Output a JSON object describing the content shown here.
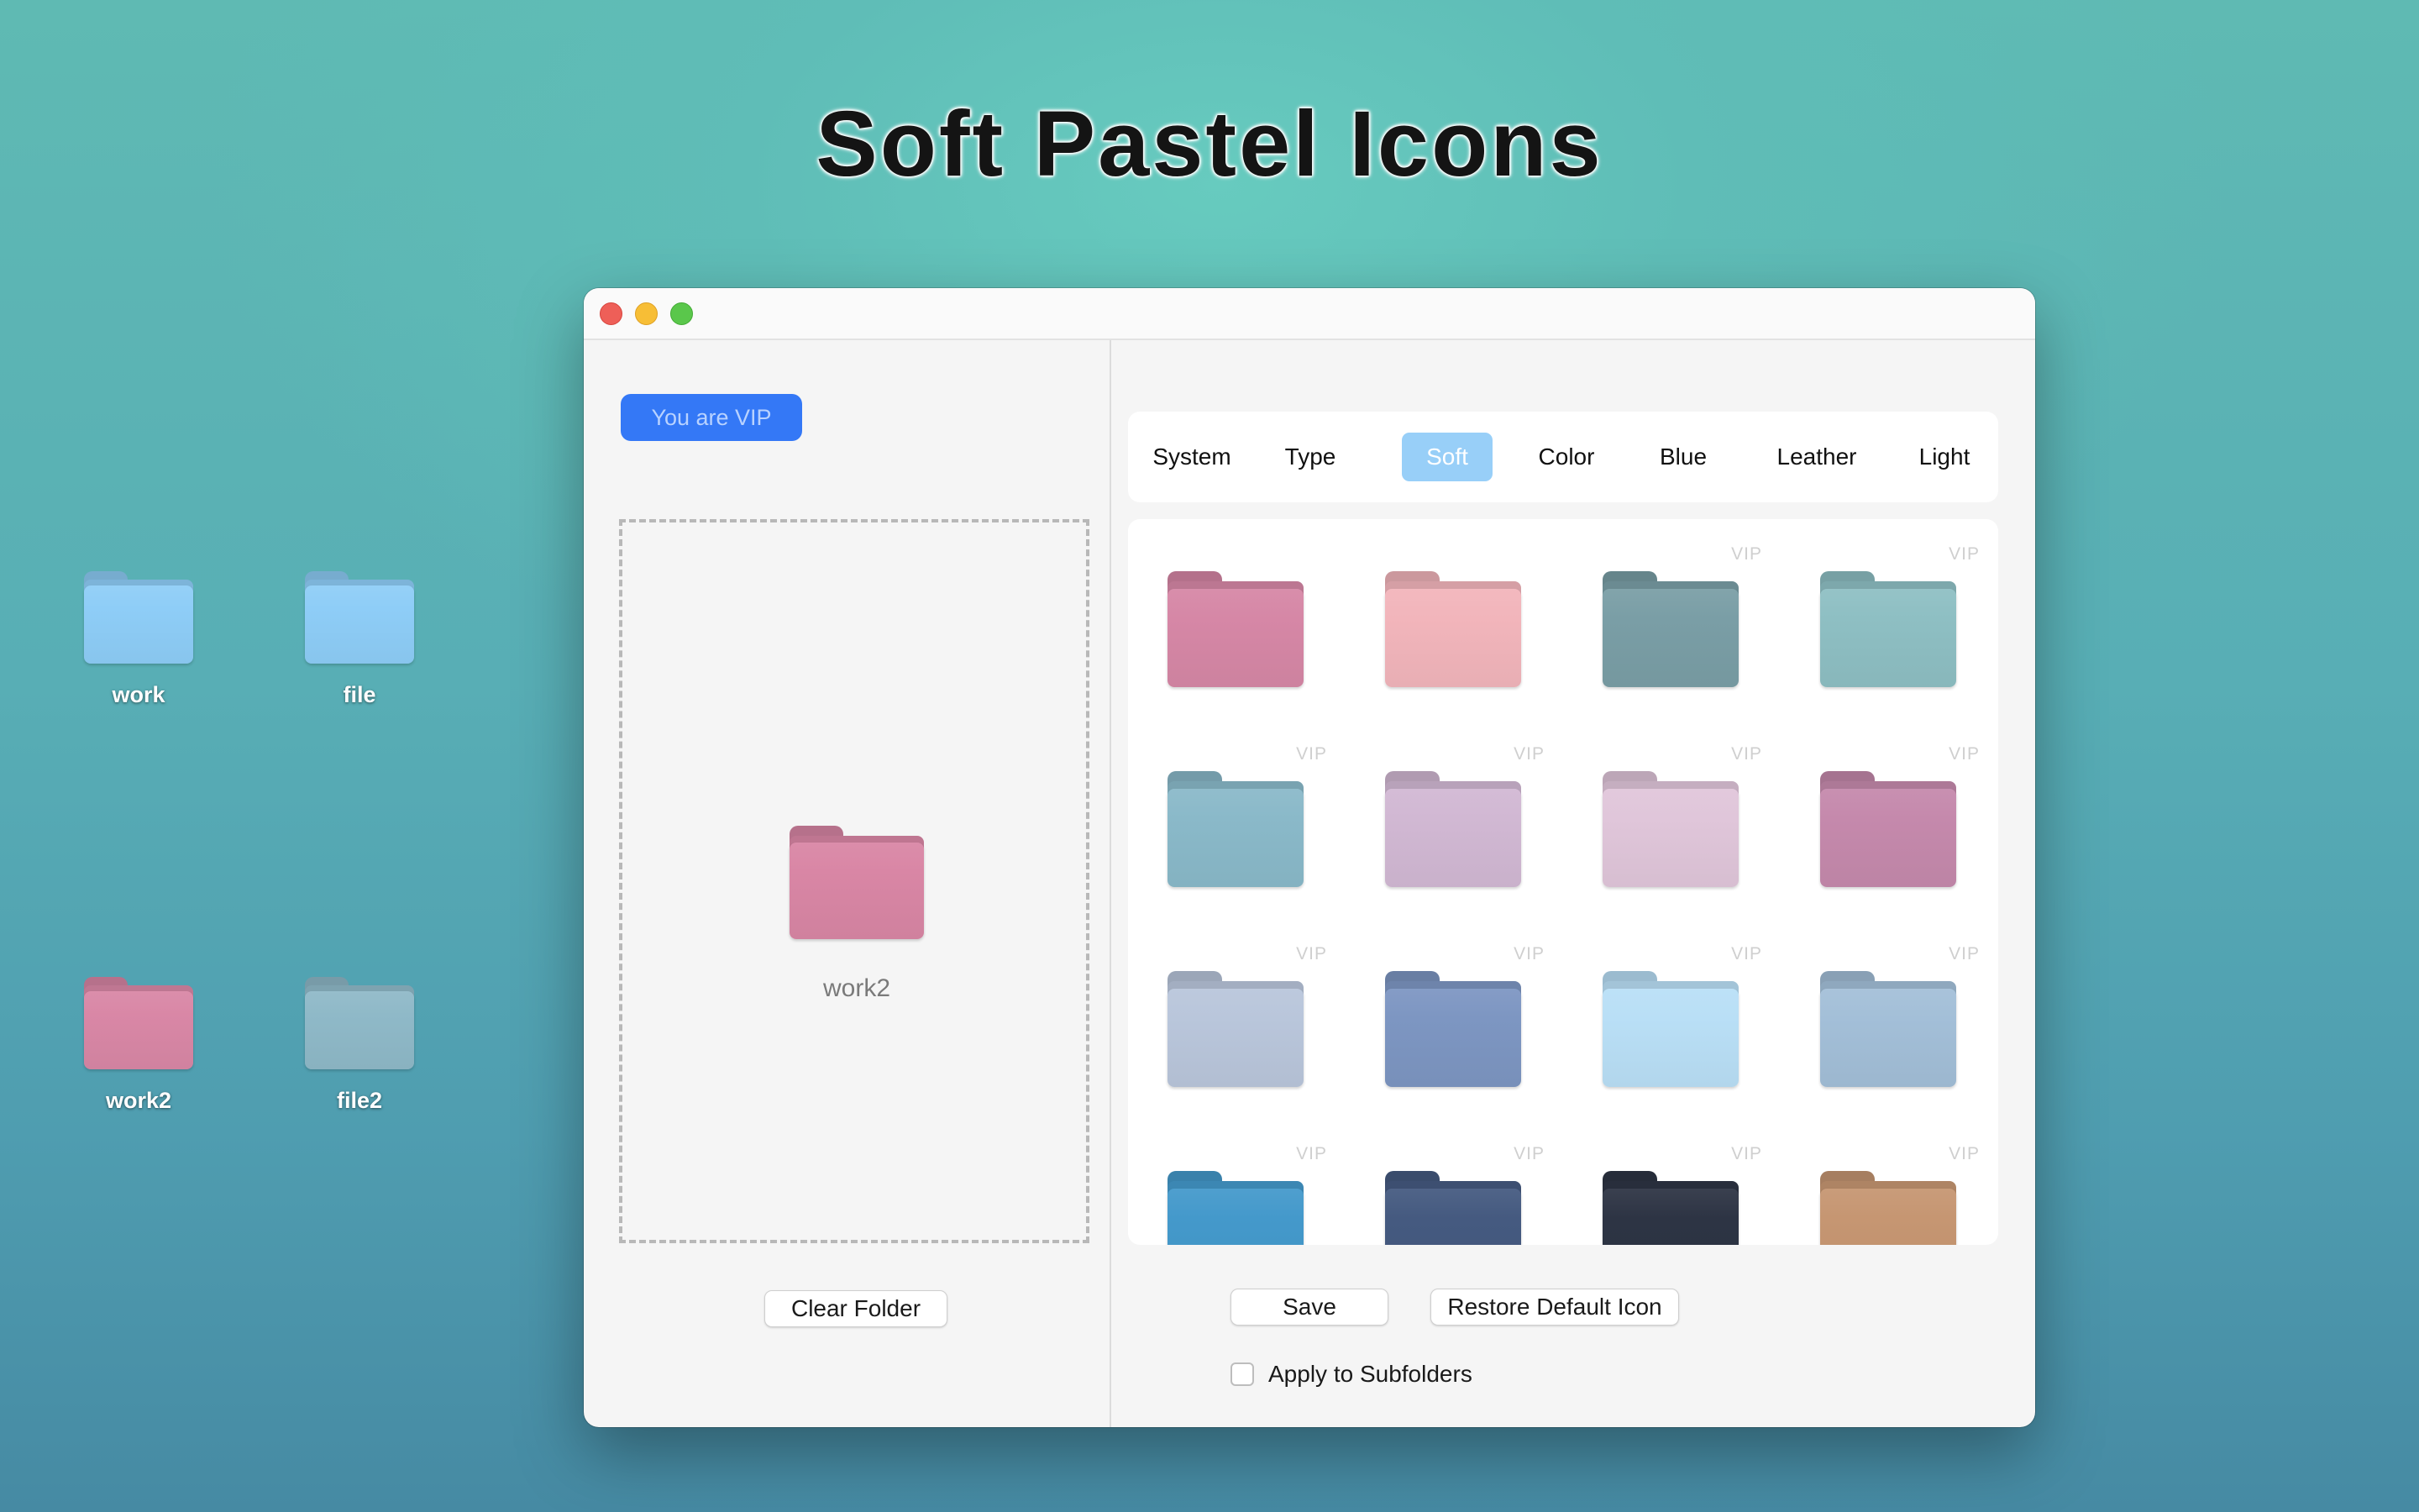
{
  "hero": {
    "title": "Soft Pastel Icons"
  },
  "desktop": {
    "icons": [
      {
        "label": "work",
        "color": "#8ecdf7"
      },
      {
        "label": "file",
        "color": "#8ecdf7"
      },
      {
        "label": "work2",
        "color": "#d987a6"
      },
      {
        "label": "file2",
        "color": "#8fb9c8"
      }
    ]
  },
  "window": {
    "vip_badge": "You are VIP",
    "drop_zone": {
      "folder_name": "work2",
      "folder_color": "#d986a5"
    },
    "clear_button": "Clear Folder",
    "tabs": [
      {
        "label": "System",
        "active": false
      },
      {
        "label": "Type",
        "active": false
      },
      {
        "label": "Soft",
        "active": true
      },
      {
        "label": "Color",
        "active": false
      },
      {
        "label": "Blue",
        "active": false
      },
      {
        "label": "Leather",
        "active": false
      },
      {
        "label": "Light",
        "active": false
      }
    ],
    "icon_grid": [
      {
        "color": "#d687a6",
        "vip": false
      },
      {
        "color": "#f2b5bb",
        "vip": false
      },
      {
        "color": "#7a9ea6",
        "vip": true
      },
      {
        "color": "#8ebfc3",
        "vip": true
      },
      {
        "color": "#8ab9c9",
        "vip": true
      },
      {
        "color": "#d1b8d3",
        "vip": true
      },
      {
        "color": "#e0c6da",
        "vip": true
      },
      {
        "color": "#c589ac",
        "vip": true
      },
      {
        "color": "#b9c6db",
        "vip": true
      },
      {
        "color": "#7d96c2",
        "vip": true
      },
      {
        "color": "#b9dff6",
        "vip": true
      },
      {
        "color": "#a3bfd8",
        "vip": true
      },
      {
        "color": "#4499cb",
        "vip": true
      },
      {
        "color": "#455a80",
        "vip": true
      },
      {
        "color": "#2d3444",
        "vip": true
      },
      {
        "color": "#c69672",
        "vip": true
      }
    ],
    "vip_label": "VIP",
    "save_button": "Save",
    "restore_button": "Restore Default Icon",
    "apply_subfolders": {
      "label": "Apply to Subfolders",
      "checked": false
    }
  }
}
